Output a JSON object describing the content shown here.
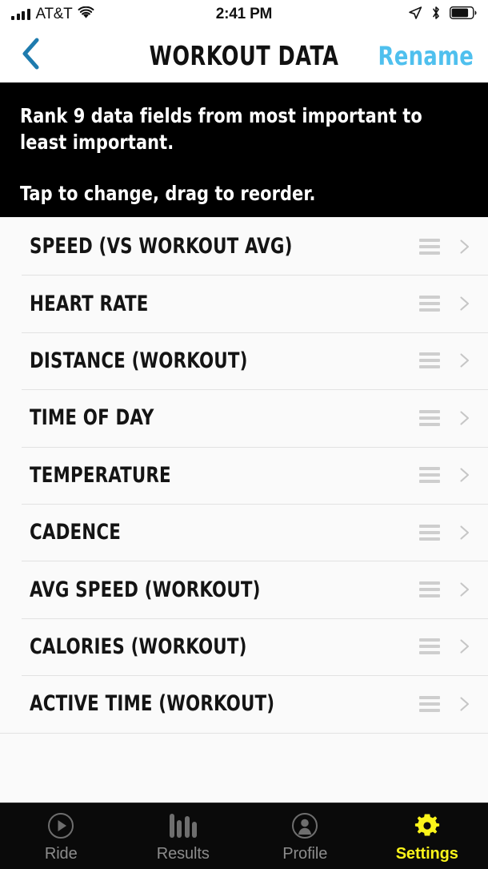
{
  "status_bar": {
    "carrier": "AT&T",
    "time": "2:41 PM",
    "signal_bars": 4,
    "icons": [
      "signal-bars-icon",
      "wifi-icon",
      "location-arrow-icon",
      "bluetooth-icon",
      "battery-icon"
    ],
    "battery_level_percent": 72
  },
  "nav": {
    "back_icon": "chevron-left-icon",
    "title": "WORKOUT DATA",
    "action_label": "Rename",
    "action_color": "#4FC0EE",
    "back_color": "#1E7BAE"
  },
  "banner": {
    "background": "#000000",
    "line1": "Rank 9 data fields from most important to least important.",
    "line2": "Tap to change, drag to reorder."
  },
  "list": {
    "background": "#FAFAFA",
    "separator_color": "#E2E2E2",
    "drag_handle_icon": "drag-handle-icon",
    "disclosure_icon": "chevron-right-icon",
    "items": [
      {
        "rank": 1,
        "label": "SPEED (VS WORKOUT AVG)"
      },
      {
        "rank": 2,
        "label": "HEART RATE"
      },
      {
        "rank": 3,
        "label": "DISTANCE (WORKOUT)"
      },
      {
        "rank": 4,
        "label": "TIME OF DAY"
      },
      {
        "rank": 5,
        "label": "TEMPERATURE"
      },
      {
        "rank": 6,
        "label": "CADENCE"
      },
      {
        "rank": 7,
        "label": "AVG SPEED (WORKOUT)"
      },
      {
        "rank": 8,
        "label": "CALORIES (WORKOUT)"
      },
      {
        "rank": 9,
        "label": "ACTIVE TIME (WORKOUT)"
      }
    ]
  },
  "tabbar": {
    "background": "#0A0A0A",
    "active_color": "#FAF41A",
    "inactive_color": "#8C8C8C",
    "tabs": [
      {
        "label": "Ride",
        "icon": "play-circle-icon",
        "active": false
      },
      {
        "label": "Results",
        "icon": "bar-chart-icon",
        "active": false
      },
      {
        "label": "Profile",
        "icon": "person-circle-icon",
        "active": false
      },
      {
        "label": "Settings",
        "icon": "gear-icon",
        "active": true
      }
    ]
  }
}
